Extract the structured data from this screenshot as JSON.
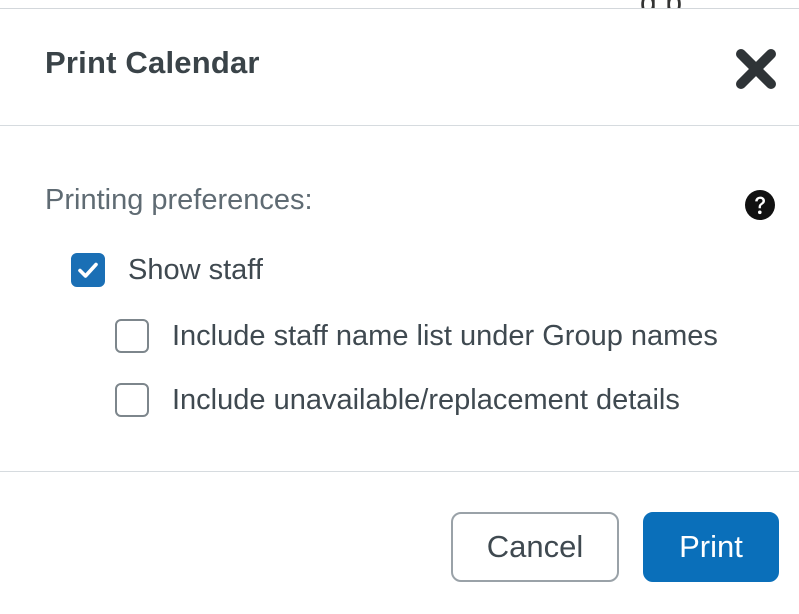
{
  "background": {
    "cut_text": "g  p"
  },
  "dialog": {
    "title": "Print Calendar",
    "close_icon": "close-x-icon",
    "section_label": "Printing preferences:",
    "help_icon": "question-circle-icon",
    "options": [
      {
        "label": "Show staff",
        "checked": true
      },
      {
        "label": "Include staff name list under Group names",
        "checked": false
      },
      {
        "label": "Include unavailable/replacement details",
        "checked": false
      }
    ],
    "buttons": {
      "cancel": "Cancel",
      "print": "Print"
    },
    "colors": {
      "primary": "#0a6fba",
      "checkbox_checked": "#1a6fb5",
      "title_text": "#3a4348",
      "divider": "#d6dbdf"
    }
  }
}
